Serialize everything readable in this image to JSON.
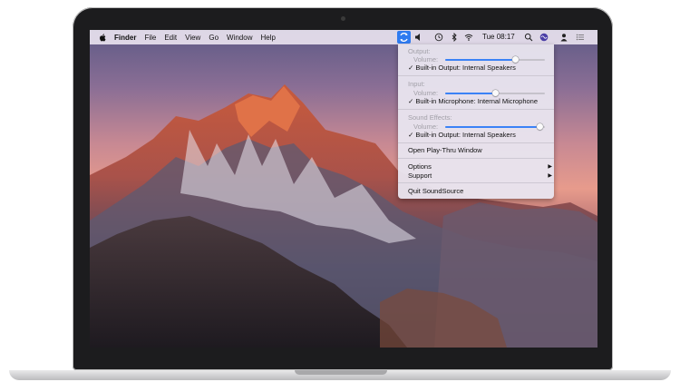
{
  "menubar": {
    "app_name": "Finder",
    "menus": [
      "File",
      "Edit",
      "View",
      "Go",
      "Window",
      "Help"
    ],
    "clock": "Tue 08:17"
  },
  "dropdown": {
    "output_header": "Output:",
    "output_volume_label": "Volume:",
    "output_volume_level": 0.7,
    "output_device": "✓ Built-in Output: Internal Speakers",
    "input_header": "Input:",
    "input_volume_label": "Volume:",
    "input_volume_level": 0.5,
    "input_device": "✓ Built-in Microphone: Internal Microphone",
    "effects_header": "Sound Effects:",
    "effects_volume_label": "Volume:",
    "effects_volume_level": 0.95,
    "effects_device": "✓ Built-in Output: Internal Speakers",
    "play_thru": "Open Play-Thru Window",
    "options": "Options",
    "support": "Support",
    "submenu_arrow": "▶",
    "quit": "Quit SoundSource"
  },
  "colors": {
    "accent": "#2f7bf0",
    "slider_fill": "#3b82f6"
  }
}
